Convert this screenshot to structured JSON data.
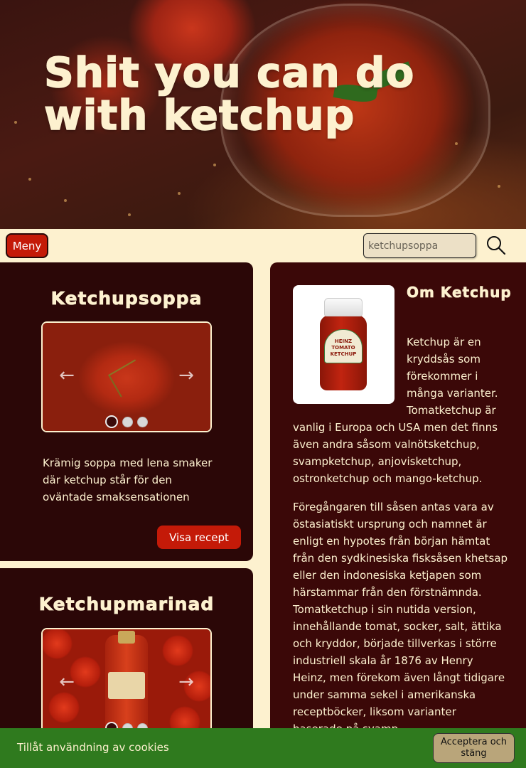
{
  "hero": {
    "title": "Shit you can do with ketchup"
  },
  "nav": {
    "menu_label": "Meny",
    "search_placeholder": "ketchupsoppa"
  },
  "cards": [
    {
      "title": "Ketchupsoppa",
      "description": "Krämig soppa med lena smaker där ketchup står för den oväntade smaksensationen",
      "button_label": "Visa recept",
      "carousel": {
        "slides": 3,
        "active": 1
      }
    },
    {
      "title": "Ketchupmarinad",
      "carousel": {
        "slides": 3,
        "active": 1
      }
    }
  ],
  "article": {
    "title": "Om Ketchup",
    "paragraphs": [
      "Ketchup är en kryddsås som förekommer i många varianter. Tomatketchup är vanlig i Europa och USA men det finns även andra såsom valnötsketchup, svampketchup, anjovisketchup, ostronketchup och mango-ketchup.",
      "Föregångaren till såsen antas vara av östasiatiskt ursprung och namnet är enligt en hypotes från början hämtat från den sydkinesiska fisksåsen khetsap eller den indonesiska ketjapen som härstammar från den förstnämnda. Tomatketchup i sin nutida version, innehållande tomat, socker, salt, ättika och kryddor, började tillverkas i större industriell skala år 1876 av Henry Heinz, men förekom även långt tidigare under samma sekel i amerikanska receptböcker, liksom varianter baserade på svamp."
    ]
  },
  "cookie": {
    "text": "Tillåt användning av cookies",
    "button_label": "Acceptera och stäng"
  },
  "colors": {
    "cream": "#fdf1cf",
    "dark_red": "#2b0707",
    "brand_red": "#c41a08",
    "cookie_green": "#2f7a1e"
  },
  "icons": [
    "search-icon",
    "chevron-left-icon",
    "chevron-right-icon"
  ]
}
